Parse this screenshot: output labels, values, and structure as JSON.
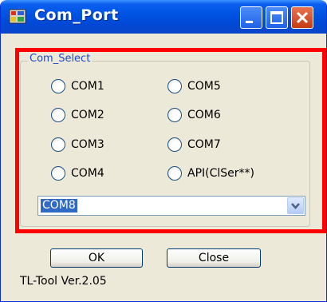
{
  "window": {
    "title": "Com_Port",
    "icon": "app-icon",
    "controls": [
      "minimize-icon",
      "maximize-icon",
      "close-icon"
    ]
  },
  "group": {
    "legend": "Com_Select",
    "options_left": [
      "COM1",
      "COM2",
      "COM3",
      "COM4"
    ],
    "options_right": [
      "COM5",
      "COM6",
      "COM7",
      "API(ClSer**)"
    ]
  },
  "combo": {
    "value": "COM8",
    "arrow_icon": "chevron-down-icon"
  },
  "buttons": {
    "ok": "OK",
    "close": "Close"
  },
  "footer": {
    "version": "TL-Tool Ver.2.05"
  },
  "colors": {
    "titlebar": "#0054e3",
    "window_bg": "#ece9d8",
    "annotation": "#ff0000",
    "selection": "#316ac5",
    "legend_text": "#1f48c8"
  }
}
